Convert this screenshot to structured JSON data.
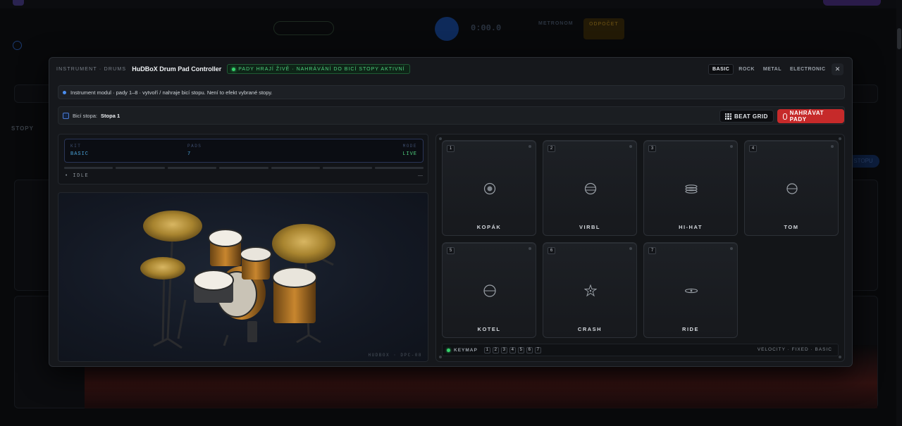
{
  "background": {
    "stopy_label": "STOPY",
    "stopa_label": "Stopa",
    "metronome_label": "METRONOM",
    "countdown_label": "ODPOČET",
    "time_display": "0:00.0",
    "right_btn_label": "STOPU"
  },
  "modal": {
    "breadcrumb": "INSTRUMENT · DRUMS",
    "title": "HuDBoX Drum Pad Controller",
    "live_badge": "PADY HRAJÍ ŽIVĚ · NAHRÁVÁNÍ DO BICÍ STOPY AKTIVNÍ",
    "kit_tabs": [
      "BASIC",
      "ROCK",
      "METAL",
      "ELECTRONIC"
    ],
    "active_kit": "BASIC",
    "close_label": "✕",
    "info_text": "Instrument modul · pady 1–8 · vytvoří / nahraje bicí stopu. Není to efekt vybrané stopy.",
    "track_prefix": "Bicí stopa:",
    "track_name": "Stopa 1",
    "beat_grid_label": "BEAT GRID",
    "record_label": "NAHRÁVAT PADY"
  },
  "status": {
    "kit_label": "KIT",
    "kit_value": "BASIC",
    "pads_label": "PADS",
    "pads_value": "7",
    "mode_label": "MODE",
    "mode_value": "LIVE",
    "state": "IDLE",
    "state_dash": "—"
  },
  "kit_view": {
    "caption": "HUDBOX · DPC-08"
  },
  "pads": [
    {
      "num": "1",
      "label": "KOPÁK",
      "icon": "kick-icon"
    },
    {
      "num": "2",
      "label": "VIRBL",
      "icon": "snare-icon"
    },
    {
      "num": "3",
      "label": "HI-HAT",
      "icon": "hihat-icon"
    },
    {
      "num": "4",
      "label": "TOM",
      "icon": "tom-icon"
    },
    {
      "num": "5",
      "label": "KOTEL",
      "icon": "floor-tom-icon"
    },
    {
      "num": "6",
      "label": "CRASH",
      "icon": "crash-icon"
    },
    {
      "num": "7",
      "label": "RIDE",
      "icon": "ride-icon"
    }
  ],
  "keymap": {
    "label": "KEYMAP",
    "keys": [
      "1",
      "2",
      "3",
      "4",
      "5",
      "6",
      "7"
    ],
    "right_text": "VELOCITY · FIXED · BASIC"
  }
}
